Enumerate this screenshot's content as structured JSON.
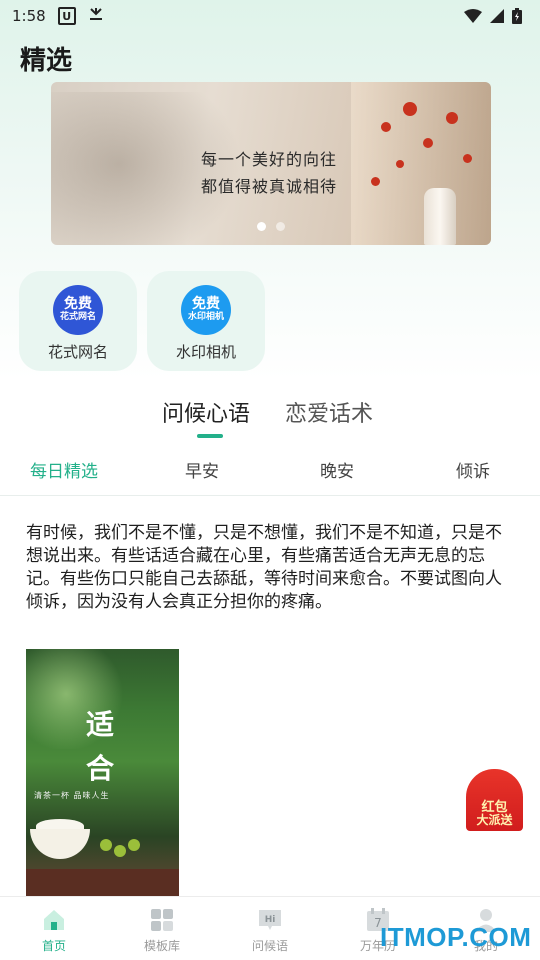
{
  "status_bar": {
    "time": "1:58",
    "app_icon_letter": "U"
  },
  "header": {
    "title": "精选"
  },
  "banner": {
    "line1": "每一个美好的向往",
    "line2": "都值得被真诚相待",
    "active_index": 0,
    "count": 2
  },
  "quick_actions": [
    {
      "badge_top": "免费",
      "badge_sub": "花式网名",
      "label": "花式网名",
      "color": "#2f56d6"
    },
    {
      "badge_top": "免费",
      "badge_sub": "水印相机",
      "label": "水印相机",
      "color": "#1d9bf0"
    }
  ],
  "main_tabs": [
    {
      "label": "问候心语",
      "active": true
    },
    {
      "label": "恋爱话术",
      "active": false
    }
  ],
  "sub_tabs": [
    {
      "label": "每日精选",
      "active": true
    },
    {
      "label": "早安",
      "active": false
    },
    {
      "label": "晚安",
      "active": false
    },
    {
      "label": "倾诉",
      "active": false
    }
  ],
  "post": {
    "text": "有时候，我们不是不懂，只是不想懂，我们不是不知道，只是不想说出来。有些话适合藏在心里，有些痛苦适合无声无息的忘记。有些伤口只能自己去舔舐，等待时间来愈合。不要试图向人倾诉，因为没有人会真正分担你的疼痛。",
    "image_char1": "适",
    "image_char2": "合",
    "image_subtext": "清茶一杯 品味人生"
  },
  "red_packet": {
    "line1": "红包",
    "line2": "大派送"
  },
  "bottom_nav": [
    {
      "label": "首页",
      "icon": "home-icon",
      "active": true
    },
    {
      "label": "模板库",
      "icon": "grid-icon",
      "active": false
    },
    {
      "label": "问候语",
      "icon": "hi-chat-icon",
      "active": false
    },
    {
      "label": "万年历",
      "icon": "calendar-icon",
      "active": false
    },
    {
      "label": "我的",
      "icon": "user-icon",
      "active": false
    }
  ],
  "calendar_day": "7",
  "watermark": "ITMOP.COM",
  "colors": {
    "accent": "#23b08a",
    "red_packet": "#d11d1d"
  }
}
